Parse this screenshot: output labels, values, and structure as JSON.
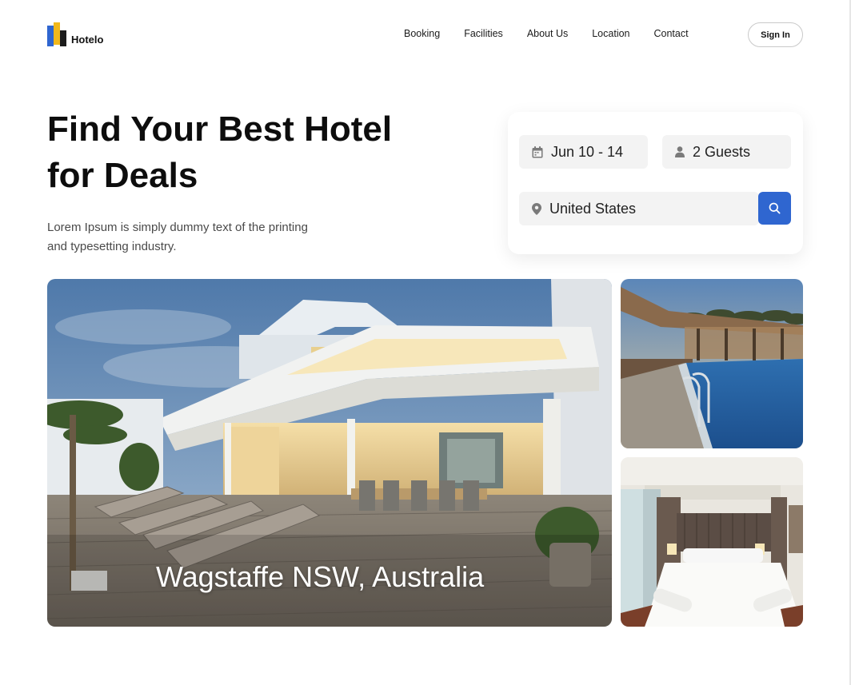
{
  "brand": {
    "name": "Hotelo",
    "colors": {
      "blue": "#2f66d0",
      "yellow": "#f2b81b",
      "dark": "#1c1c1c"
    }
  },
  "nav": {
    "items": [
      "Booking",
      "Facilities",
      "About Us",
      "Location",
      "Contact"
    ],
    "signin_label": "Sign In"
  },
  "hero": {
    "title_line1": "Find Your Best Hotel",
    "title_line2": "for Deals",
    "subtitle_line1": "Lorem Ipsum is simply dummy text of the printing",
    "subtitle_line2": "and typesetting industry."
  },
  "search": {
    "date": {
      "value": "Jun 10 - 14",
      "icon": "calendar-icon"
    },
    "guests": {
      "value": "2 Guests",
      "icon": "user-icon"
    },
    "location": {
      "value": "United States",
      "icon": "location-pin-icon"
    },
    "button_icon": "search-icon"
  },
  "gallery": {
    "main_caption": "Wagstaffe NSW, Australia"
  }
}
